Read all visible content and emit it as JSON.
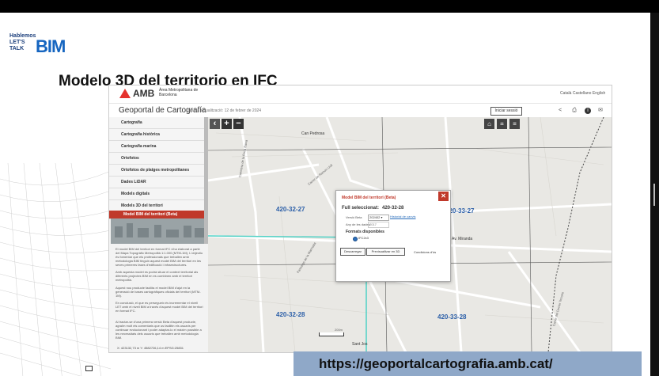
{
  "logo": {
    "line1": "Hablemos",
    "line2": "LET'S",
    "line3": "TALK",
    "brand": "BIM"
  },
  "slide": {
    "title": "Modelo 3D del territorio en IFC",
    "url": "https://geoportalcartografia.amb.cat/"
  },
  "amb": {
    "logo_text": "AMB",
    "logo_sub": "Àrea Metropolitana de Barcelona",
    "languages": "Català  Castellano  English",
    "portal_title": "Geoportal de Cartografía",
    "last_update": "Darrera actualització: 12 de febrer de 2024",
    "login_label": "Iniciar sessió",
    "toolbar_icons": [
      "share-icon",
      "print-icon",
      "info-icon",
      "mail-icon"
    ]
  },
  "sidebar": {
    "items": [
      {
        "label": "Cartografia"
      },
      {
        "label": "Cartografia històrica"
      },
      {
        "label": "Cartografia marina"
      },
      {
        "label": "Ortofotos"
      },
      {
        "label": "Ortofotos de platges metropolitanes"
      },
      {
        "label": "Dades LiDAR"
      },
      {
        "label": "Models digitals"
      },
      {
        "label": "Models 3D del territori"
      }
    ],
    "active_sub": "Model BIM del territori (Beta)",
    "paragraphs": [
      "El model BIM del territori en format IFC s'ha elaborat a partir del Mapa Topogràfic Metropolità 1:1.000 (MTM-1M). L'objectiu és fomentar que els professionals que treballen amb metodologia BIM tinguin aquest model BIM del territori en les seves primeres fases d'edificació i infraestructures.",
      "Amb aquesta model es podrà situar el context territorial als diferents projectes BIM en es combinen amb el territori metropolità.",
      "Aquest nou producte facilita el model BIM d'ajut en la generació de bases cartogràfiques oficials del territori (MTM-1M).",
      "En conclusió, el que es persegueix és incrementar el nivell LET amb el nivell BIM a través d'aquest model BIM del territori en format IFC.",
      "Al tractar-se d'una primera versió Beta d'aquest producte, agraïm molt els comentaris que us facilitin els usuaris per continuar evolucionant i poder adaptar-lo el màxim possible a les necessitats dels usuaris que treballen amb metodologia BIM."
    ]
  },
  "map": {
    "tiles": [
      "420-32-27",
      "420-33-27",
      "420-32-28",
      "420-33-28"
    ],
    "places": [
      "Can Pedrosa",
      "Sant Jos",
      "Av. Miranda"
    ],
    "streets": [
      "Carretera de la Roca Baixa",
      "Passatge de la Marinada",
      "Carrer de Ramon Llull",
      "Carrer del Doctor Tenorio"
    ],
    "coords": "X: 423132,73 m  Y: 4582726,14 m  EPSG:25831",
    "scale": "200m",
    "controls": {
      "back": "‹",
      "zoom_in": "+",
      "zoom_out": "−"
    }
  },
  "modal": {
    "title": "Model BIM del territori (Beta)",
    "close": "✕",
    "selected_label": "Full seleccionat:",
    "selected_value": "420-32-28",
    "version_label": "Versió Beta",
    "version_value": "202402",
    "history_link": "Historial de canvis",
    "year_label": "Any de les dades",
    "year_value": "2017",
    "formats_title": "Formats disponibles",
    "format_option": "IFC2x3",
    "download_label": "Descarregar",
    "preview_label": "Previsualitzar en 3D",
    "terms_label": "Condicions d'ús"
  },
  "colors": {
    "accent_red": "#c0392b",
    "tile_label_blue": "#2c5fa8",
    "banner_blue": "#8fa8c8"
  }
}
